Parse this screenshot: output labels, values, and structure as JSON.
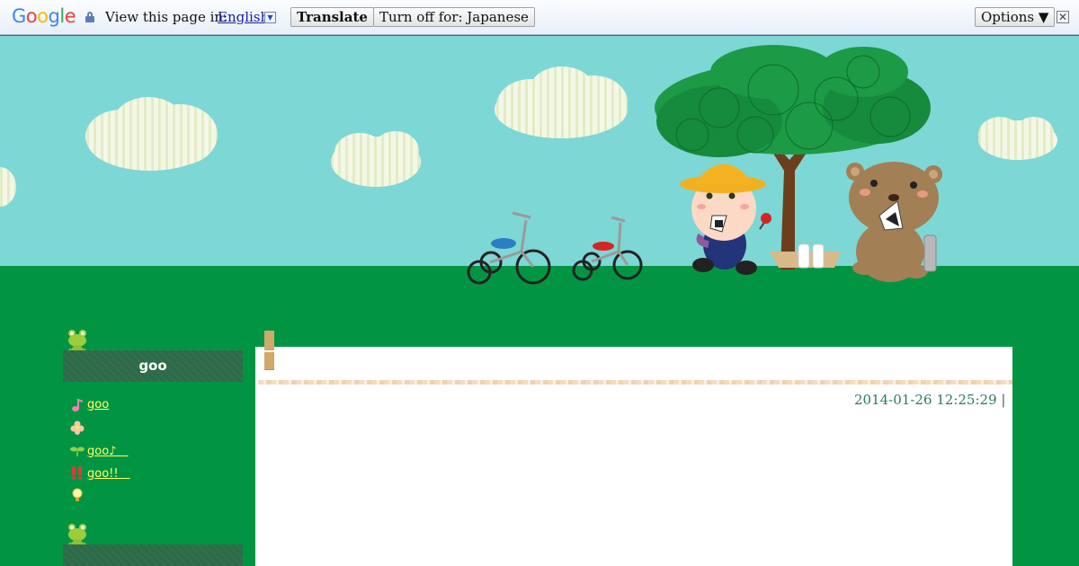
{
  "translate_bar": {
    "logo": "Google",
    "view_text": "View this page in:",
    "language": "English",
    "translate_label": "Translate",
    "turn_off_label": "Turn off for: Japanese",
    "options_label": "Options ▼",
    "close_glyph": "✕"
  },
  "sidebar": {
    "section_title": "goo",
    "items": [
      {
        "icon": "music-note-icon",
        "label": "goo"
      },
      {
        "icon": "flower-icon",
        "label": ""
      },
      {
        "icon": "sprout-icon",
        "label": "goo♪　"
      },
      {
        "icon": "exclamation-icon",
        "label": "goo!!　"
      },
      {
        "icon": "lightbulb-icon",
        "label": ""
      }
    ]
  },
  "post": {
    "datetime": "2014-01-26 12:25:29",
    "separator": "|"
  },
  "colors": {
    "sky": "#7dd7d5",
    "grass": "#019543",
    "link": "#ffff66",
    "sidebar_head": "#2d6a48"
  }
}
